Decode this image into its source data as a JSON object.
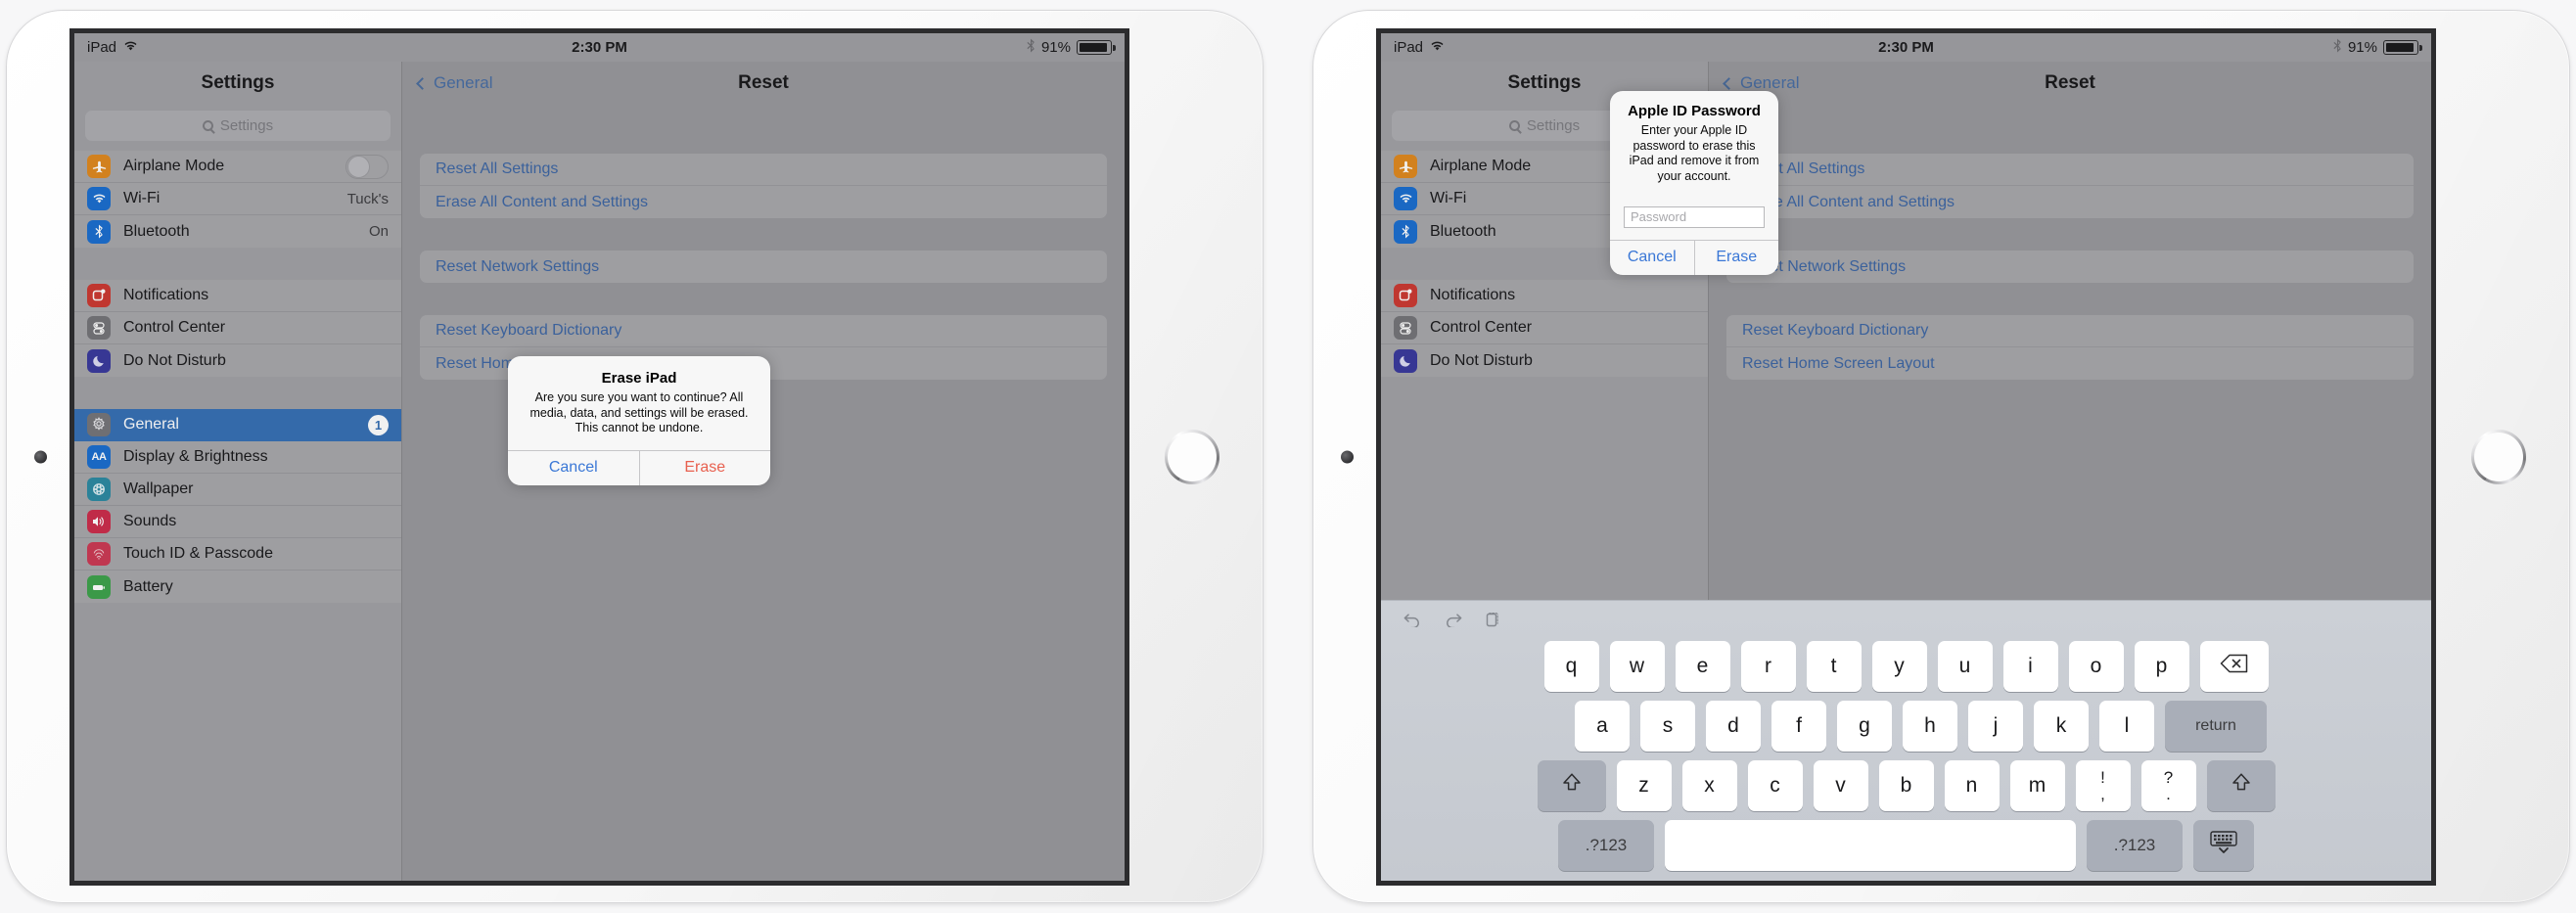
{
  "statusbar": {
    "device_name": "iPad",
    "wifi_icon": "wifi-icon",
    "time": "2:30 PM",
    "bluetooth_icon": "bluetooth-icon",
    "battery_percent": "91%"
  },
  "sidebar": {
    "title": "Settings",
    "search": {
      "placeholder": "Settings",
      "icon": "search-icon"
    },
    "groups": [
      {
        "items": [
          {
            "label": "Airplane Mode",
            "icon": "airplane-icon",
            "accessory": "toggle",
            "value": ""
          },
          {
            "label": "Wi-Fi",
            "icon": "wifi-icon",
            "accessory": "value",
            "value": "Tuck's"
          },
          {
            "label": "Bluetooth",
            "icon": "bluetooth-icon",
            "accessory": "value",
            "value": "On"
          }
        ]
      },
      {
        "items": [
          {
            "label": "Notifications",
            "icon": "notifications-icon",
            "accessory": "none",
            "value": ""
          },
          {
            "label": "Control Center",
            "icon": "control-center-icon",
            "accessory": "none",
            "value": ""
          },
          {
            "label": "Do Not Disturb",
            "icon": "moon-icon",
            "accessory": "none",
            "value": ""
          }
        ]
      },
      {
        "items": [
          {
            "label": "General",
            "icon": "gear-icon",
            "accessory": "badge",
            "value": "1",
            "selected": true
          },
          {
            "label": "Display & Brightness",
            "icon": "display-icon",
            "accessory": "none",
            "value": ""
          },
          {
            "label": "Wallpaper",
            "icon": "wallpaper-icon",
            "accessory": "none",
            "value": ""
          },
          {
            "label": "Sounds",
            "icon": "sounds-icon",
            "accessory": "none",
            "value": ""
          },
          {
            "label": "Touch ID & Passcode",
            "icon": "fingerprint-icon",
            "accessory": "none",
            "value": ""
          },
          {
            "label": "Battery",
            "icon": "battery-icon",
            "accessory": "none",
            "value": ""
          }
        ]
      }
    ]
  },
  "detail": {
    "back_label": "General",
    "title": "Reset",
    "groups": [
      {
        "items": [
          "Reset All Settings",
          "Erase All Content and Settings"
        ]
      },
      {
        "items": [
          "Reset Network Settings"
        ]
      },
      {
        "items": [
          "Reset Keyboard Dictionary",
          "Reset Home Screen Layout"
        ]
      }
    ]
  },
  "alert_erase": {
    "title": "Erase iPad",
    "message_line1": "Are you sure you want to continue? All media, data, and settings will be erased.",
    "message_line2": "This cannot be undone.",
    "cancel": "Cancel",
    "confirm": "Erase"
  },
  "alert_password": {
    "title": "Apple ID Password",
    "message": "Enter your Apple ID password to erase this iPad and remove it from your account.",
    "field_placeholder": "Password",
    "field_value": "",
    "cancel": "Cancel",
    "confirm": "Erase"
  },
  "keyboard": {
    "toolbar": [
      {
        "name": "undo-icon"
      },
      {
        "name": "redo-icon"
      },
      {
        "name": "paste-icon"
      }
    ],
    "row1": [
      "q",
      "w",
      "e",
      "r",
      "t",
      "y",
      "u",
      "i",
      "o",
      "p"
    ],
    "row1_extra": {
      "label": "backspace-icon"
    },
    "row2": [
      "a",
      "s",
      "d",
      "f",
      "g",
      "h",
      "j",
      "k",
      "l"
    ],
    "row2_extra": {
      "label": "return"
    },
    "row3": [
      "z",
      "x",
      "c",
      "v",
      "b",
      "n",
      "m"
    ],
    "row3_punct": [
      {
        "top": "!",
        "bottom": ","
      },
      {
        "top": "?",
        "bottom": "."
      }
    ],
    "shift_label": "shift-icon",
    "row4": {
      "numbers_left": ".?123",
      "space": "",
      "numbers_right": ".?123",
      "dismiss": "keyboard-dismiss-icon"
    }
  },
  "colors": {
    "accent_blue": "#3f68a5",
    "danger_red": "#e8604f",
    "selected_row": "#3871b5",
    "screen_bg": "#9a9a9e"
  }
}
